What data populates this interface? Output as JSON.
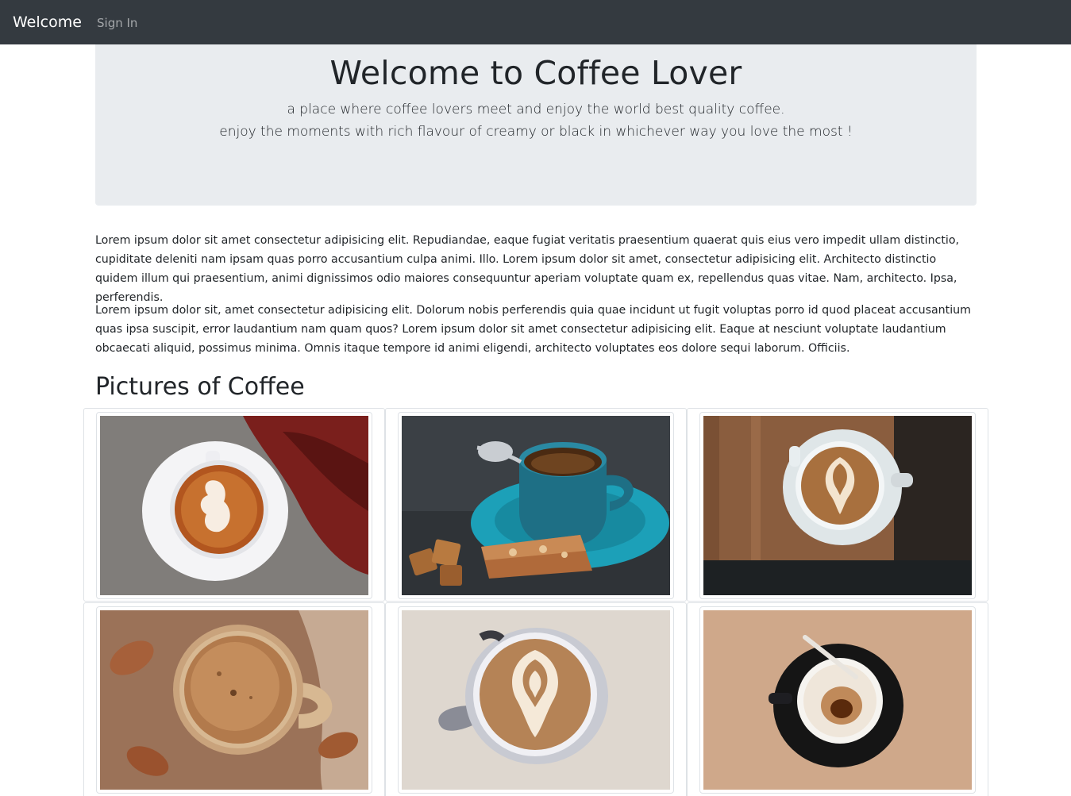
{
  "navbar": {
    "brand": "Welcome",
    "links": [
      {
        "label": "Sign In"
      }
    ]
  },
  "hero": {
    "title": "Welcome to Coffee Lover",
    "lead_lines": [
      "a place where coffee lovers meet and enjoy the world best quality coffee.",
      "enjoy the moments with rich flavour of creamy or black in whichever way you love the most !"
    ]
  },
  "content": {
    "paragraphs": [
      "Lorem ipsum dolor sit amet consectetur adipisicing elit. Repudiandae, eaque fugiat veritatis praesentium quaerat quis eius vero impedit ullam distinctio, cupiditate deleniti nam ipsam quas porro accusantium culpa animi. Illo. Lorem ipsum dolor sit amet, consectetur adipisicing elit. Architecto distinctio quidem illum qui praesentium, animi dignissimos odio maiores consequuntur aperiam voluptate quam ex, repellendus quas vitae. Nam, architecto. Ipsa, perferendis.",
      "Lorem ipsum dolor sit, amet consectetur adipisicing elit. Dolorum nobis perferendis quia quae incidunt ut fugit voluptas porro id quod placeat accusantium quas ipsa suscipit, error laudantium nam quam quos? Lorem ipsum dolor sit amet consectetur adipisicing elit. Eaque at nesciunt voluptate laudantium obcaecati aliquid, possimus minima. Omnis itaque tempore id animi eligendi, architecto voluptates eos dolore sequi laborum. Officiis."
    ]
  },
  "gallery": {
    "title": "Pictures of Coffee",
    "photos": [
      {
        "depicts": "latte art ghost on a white saucer with red leaves",
        "colors": {
          "bg": "#7c7876",
          "accent": "#7a1f1c",
          "cup": "#f4f4f6",
          "coffee": "#b2561f"
        }
      },
      {
        "depicts": "blue espresso cup with biscotti and sugar cubes",
        "colors": {
          "bg": "#3b4045",
          "accent": "#1ca0b8",
          "cup": "#1e6f85",
          "coffee": "#4a2a12"
        }
      },
      {
        "depicts": "latte art heart on wooden table, top view",
        "colors": {
          "bg": "#8a5d3e",
          "accent": "#1d2123",
          "cup": "#e8eef0",
          "coffee": "#a8703e"
        }
      },
      {
        "depicts": "foamy coffee mug on rustic wood with autumn leaves",
        "colors": {
          "bg": "#8d6247",
          "accent": "#a6603a",
          "cup": "#d7b892",
          "coffee": "#b27a4c"
        }
      },
      {
        "depicts": "latte art tulip in a white cup, top view",
        "colors": {
          "bg": "#d8cfc6",
          "accent": "#8a8c96",
          "cup": "#f0f0f4",
          "coffee": "#b58356"
        }
      },
      {
        "depicts": "empty espresso cup on black saucer on wooden table",
        "colors": {
          "bg": "#c9a182",
          "accent": "#151515",
          "cup": "#f6f4f0",
          "coffee": "#5a2a0c"
        }
      }
    ]
  }
}
